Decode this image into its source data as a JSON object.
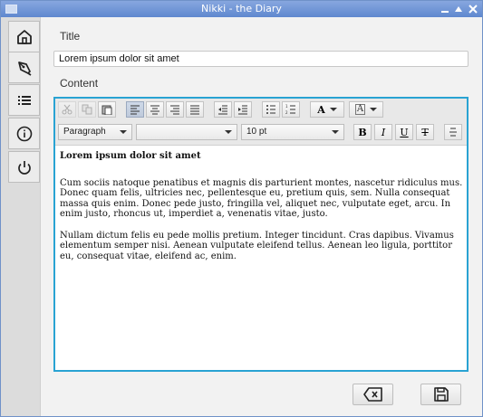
{
  "window": {
    "title": "Nikki - the Diary"
  },
  "sidebar": {
    "items": [
      {
        "name": "home",
        "icon": "home-icon"
      },
      {
        "name": "write",
        "icon": "pen-icon"
      },
      {
        "name": "list",
        "icon": "list-icon"
      },
      {
        "name": "about",
        "icon": "info-icon"
      },
      {
        "name": "quit",
        "icon": "power-icon"
      }
    ]
  },
  "form": {
    "title_label": "Title",
    "title_value": "Lorem ipsum dolor sit amet",
    "content_label": "Content"
  },
  "editor": {
    "paragraph_style": "Paragraph",
    "font_family": "",
    "font_size": "10 pt",
    "content": {
      "heading": "Lorem ipsum dolor sit amet",
      "paragraphs": [
        "Cum sociis natoque penatibus et magnis dis parturient montes, nascetur ridiculus mus. Donec quam felis, ultricies nec, pellentesque eu, pretium quis, sem. Nulla consequat massa quis enim. Donec pede justo, fringilla vel, aliquet nec, vulputate eget, arcu. In enim justo, rhoncus ut, imperdiet a, venenatis vitae, justo.",
        "Nullam dictum felis eu pede mollis pretium. Integer tincidunt. Cras dapibus. Vivamus elementum semper nisi. Aenean vulputate eleifend tellus. Aenean leo ligula, porttitor eu, consequat vitae, eleifend ac, enim."
      ]
    },
    "toolbar_icons": [
      "cut-icon",
      "copy-icon",
      "paste-icon",
      "align-left-icon",
      "align-center-icon",
      "align-right-icon",
      "align-justify-icon",
      "outdent-icon",
      "indent-icon",
      "bullet-list-icon",
      "numbered-list-icon",
      "text-color-icon",
      "background-color-icon",
      "bold-icon",
      "italic-icon",
      "underline-icon",
      "strikethrough-icon",
      "horizontal-rule-icon"
    ],
    "format_letters": {
      "bold": "B",
      "italic": "I",
      "underline": "U",
      "strike": "T",
      "text_color": "A",
      "bg_color": "A"
    }
  },
  "actions": [
    {
      "name": "discard",
      "icon": "backspace-icon"
    },
    {
      "name": "save",
      "icon": "save-icon"
    }
  ]
}
